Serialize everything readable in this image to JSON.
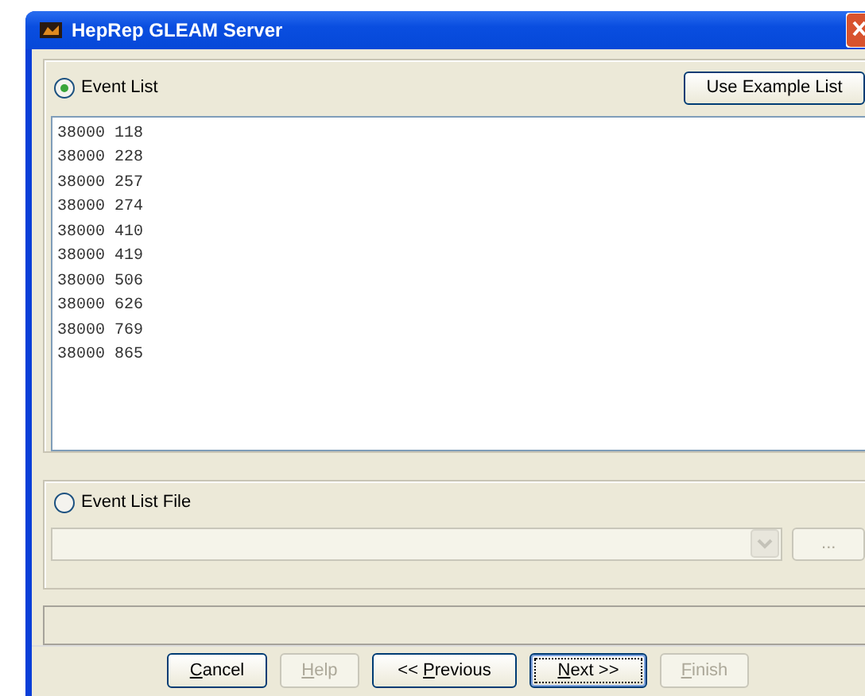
{
  "window": {
    "title": "HepRep GLEAM Server"
  },
  "event_list": {
    "label": "Event List",
    "selected": true,
    "button": "Use Example List",
    "lines": [
      "38000 118",
      "38000 228",
      "38000 257",
      "38000 274",
      "38000 410",
      "38000 419",
      "38000 506",
      "38000 626",
      "38000 769",
      "38000 865"
    ]
  },
  "event_list_file": {
    "label": "Event List File",
    "selected": false,
    "combo_disabled": true,
    "browse": {
      "label": "...",
      "disabled": true
    }
  },
  "buttons": [
    {
      "key": "C",
      "post": "ancel",
      "disabled": false,
      "default": false
    },
    {
      "key": "H",
      "post": "elp",
      "disabled": true,
      "default": false
    },
    {
      "pre": "<< ",
      "key": "P",
      "post": "revious",
      "disabled": false,
      "default": false
    },
    {
      "key": "N",
      "post": "ext >>",
      "disabled": false,
      "default": true
    },
    {
      "key": "F",
      "post": "inish",
      "disabled": true,
      "default": false
    }
  ]
}
